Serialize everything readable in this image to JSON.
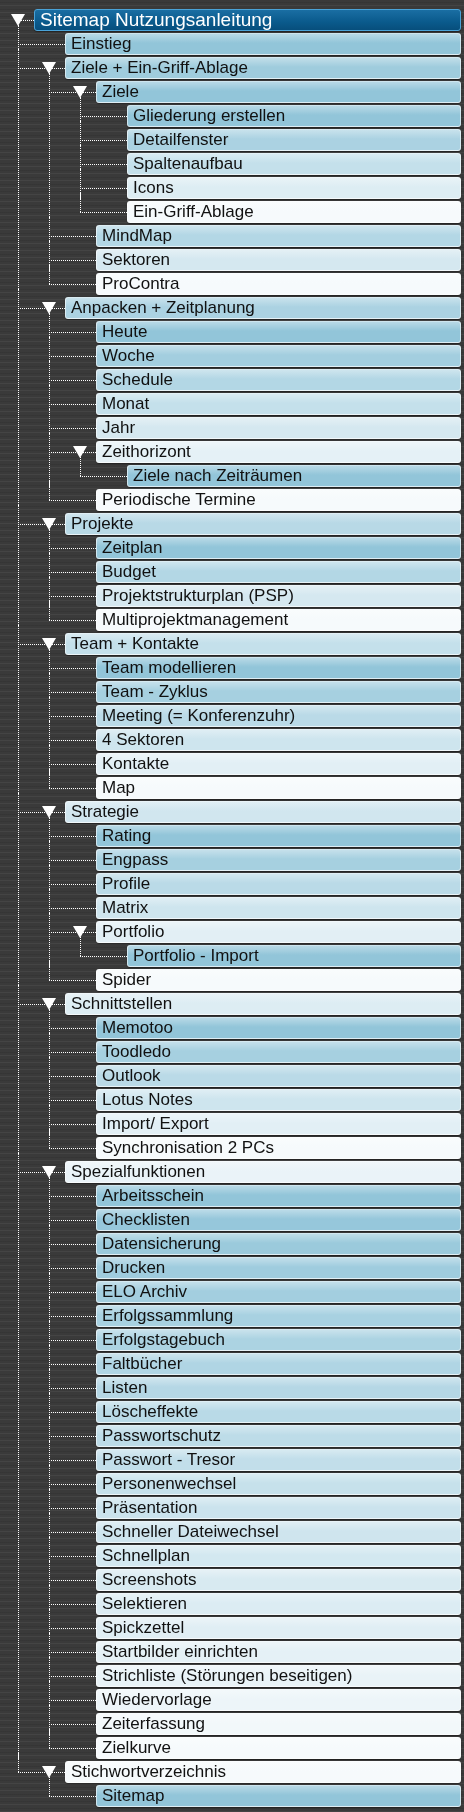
{
  "tree": [
    {
      "label": "Sitemap Nutzungsanleitung",
      "selected": true,
      "expanded": true,
      "children": [
        {
          "label": "Einstieg",
          "selected": false
        },
        {
          "label": "Ziele + Ein-Griff-Ablage",
          "selected": false,
          "expanded": true,
          "children": [
            {
              "label": "Ziele",
              "selected": false,
              "expanded": true,
              "children": [
                {
                  "label": "Gliederung erstellen",
                  "selected": false
                },
                {
                  "label": "Detailfenster",
                  "selected": false
                },
                {
                  "label": "Spaltenaufbau",
                  "selected": false
                },
                {
                  "label": "Icons",
                  "selected": false
                },
                {
                  "label": "Ein-Griff-Ablage",
                  "selected": false
                }
              ]
            },
            {
              "label": "MindMap",
              "selected": false
            },
            {
              "label": "Sektoren",
              "selected": false
            },
            {
              "label": "ProContra",
              "selected": false
            }
          ]
        },
        {
          "label": "Anpacken + Zeitplanung",
          "selected": false,
          "expanded": true,
          "children": [
            {
              "label": "Heute",
              "selected": false
            },
            {
              "label": "Woche",
              "selected": false
            },
            {
              "label": "Schedule",
              "selected": false
            },
            {
              "label": "Monat",
              "selected": false
            },
            {
              "label": "Jahr",
              "selected": false
            },
            {
              "label": "Zeithorizont",
              "selected": false,
              "expanded": true,
              "children": [
                {
                  "label": "Ziele nach Zeiträumen",
                  "selected": false
                }
              ]
            },
            {
              "label": "Periodische Termine",
              "selected": false
            }
          ]
        },
        {
          "label": "Projekte",
          "selected": false,
          "expanded": true,
          "children": [
            {
              "label": "Zeitplan",
              "selected": false
            },
            {
              "label": "Budget",
              "selected": false
            },
            {
              "label": "Projektstrukturplan (PSP)",
              "selected": false
            },
            {
              "label": "Multiprojektmanagement",
              "selected": false
            }
          ]
        },
        {
          "label": "Team + Kontakte",
          "selected": false,
          "expanded": true,
          "children": [
            {
              "label": "Team modellieren",
              "selected": false
            },
            {
              "label": "Team - Zyklus",
              "selected": false
            },
            {
              "label": "Meeting (= Konferenzuhr)",
              "selected": false
            },
            {
              "label": "4 Sektoren",
              "selected": false
            },
            {
              "label": "Kontakte",
              "selected": false
            },
            {
              "label": "Map",
              "selected": false
            }
          ]
        },
        {
          "label": "Strategie",
          "selected": false,
          "expanded": true,
          "children": [
            {
              "label": "Rating",
              "selected": false
            },
            {
              "label": "Engpass",
              "selected": false
            },
            {
              "label": "Profile",
              "selected": false
            },
            {
              "label": "Matrix",
              "selected": false
            },
            {
              "label": "Portfolio",
              "selected": false,
              "expanded": true,
              "children": [
                {
                  "label": "Portfolio - Import",
                  "selected": false
                }
              ]
            },
            {
              "label": "Spider",
              "selected": false
            }
          ]
        },
        {
          "label": "Schnittstellen",
          "selected": false,
          "expanded": true,
          "children": [
            {
              "label": "Memotoo",
              "selected": false
            },
            {
              "label": "Toodledo",
              "selected": false
            },
            {
              "label": "Outlook",
              "selected": false
            },
            {
              "label": "Lotus Notes",
              "selected": false
            },
            {
              "label": "Import/ Export",
              "selected": false
            },
            {
              "label": "Synchronisation 2 PCs",
              "selected": false
            }
          ]
        },
        {
          "label": "Spezialfunktionen",
          "selected": false,
          "expanded": true,
          "children": [
            {
              "label": "Arbeitsschein",
              "selected": false
            },
            {
              "label": "Checklisten",
              "selected": false
            },
            {
              "label": "Datensicherung",
              "selected": false
            },
            {
              "label": "Drucken",
              "selected": false
            },
            {
              "label": "ELO Archiv",
              "selected": false
            },
            {
              "label": "Erfolgssammlung",
              "selected": false
            },
            {
              "label": "Erfolgstagebuch",
              "selected": false
            },
            {
              "label": "Faltbücher",
              "selected": false
            },
            {
              "label": "Listen",
              "selected": false
            },
            {
              "label": "Löscheffekte",
              "selected": false
            },
            {
              "label": "Passwortschutz",
              "selected": false
            },
            {
              "label": "Passwort - Tresor",
              "selected": false
            },
            {
              "label": "Personenwechsel",
              "selected": false
            },
            {
              "label": "Präsentation",
              "selected": false
            },
            {
              "label": "Schneller Dateiwechsel",
              "selected": false
            },
            {
              "label": "Schnellplan",
              "selected": false
            },
            {
              "label": "Screenshots",
              "selected": false
            },
            {
              "label": "Selektieren",
              "selected": false
            },
            {
              "label": "Spickzettel",
              "selected": false
            },
            {
              "label": "Startbilder einrichten",
              "selected": false
            },
            {
              "label": "Strichliste (Störungen beseitigen)",
              "selected": false
            },
            {
              "label": "Wiedervorlage",
              "selected": false
            },
            {
              "label": "Zeiterfassung",
              "selected": false
            },
            {
              "label": "Zielkurve",
              "selected": false
            }
          ]
        },
        {
          "label": "Stichwortverzeichnis",
          "selected": false,
          "expanded": true,
          "children": [
            {
              "label": "Sitemap",
              "selected": false
            }
          ]
        }
      ]
    }
  ]
}
